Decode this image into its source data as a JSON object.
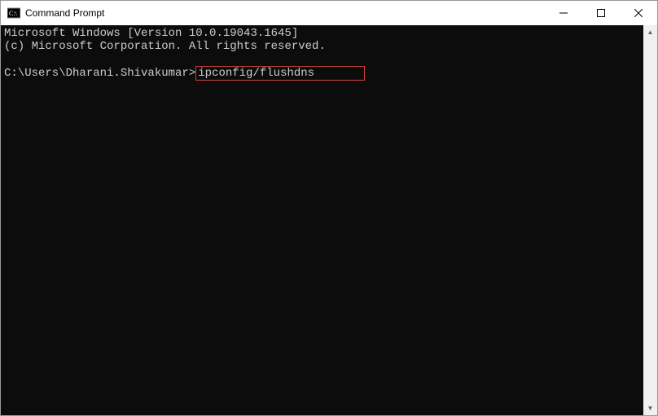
{
  "window": {
    "title": "Command Prompt"
  },
  "terminal": {
    "line1": "Microsoft Windows [Version 10.0.19043.1645]",
    "line2": "(c) Microsoft Corporation. All rights reserved.",
    "blank": "",
    "prompt": "C:\\Users\\Dharani.Shivakumar>",
    "command": "ipconfig/flushdns"
  }
}
